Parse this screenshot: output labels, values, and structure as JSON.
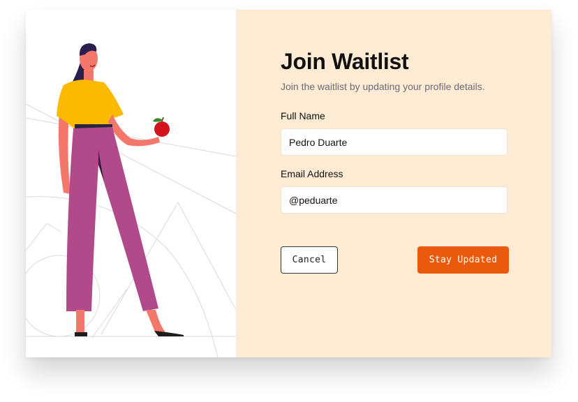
{
  "form": {
    "title": "Join Waitlist",
    "subtitle": "Join the waitlist by updating your profile details.",
    "name_label": "Full Name",
    "name_value": "Pedro Duarte",
    "email_label": "Email Address",
    "email_value": "@peduarte",
    "cancel_label": "Cancel",
    "submit_label": "Stay Updated"
  },
  "colors": {
    "panel_bg": "#fdebd3",
    "accent": "#e95a0c",
    "shirt": "#fbb900",
    "pants": "#b04a8a",
    "skin": "#f3776b",
    "apple": "#d4141c"
  },
  "icons": [
    "person-illustration",
    "apple-icon"
  ]
}
